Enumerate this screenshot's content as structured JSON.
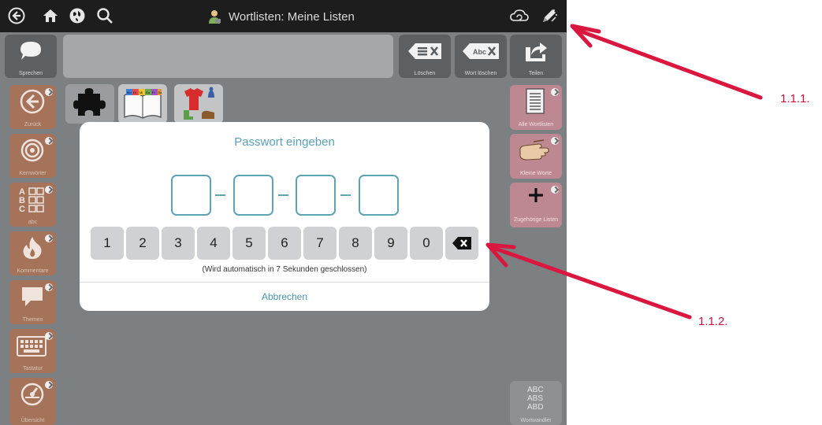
{
  "topbar": {
    "title": "Wortlisten: Meine Listen",
    "icons": [
      "back-icon",
      "home-icon",
      "globe-icon",
      "search-icon",
      "user-icon",
      "cloud-sync-icon",
      "edit-icon"
    ]
  },
  "toolbar": {
    "speak_label": "Sprechen",
    "delete_label": "Löschen",
    "delete_word_label": "Wort löschen",
    "delete_word_icon_text": "Abc",
    "share_label": "Teilen"
  },
  "left_column": {
    "items": [
      {
        "label": "Zurück",
        "icon": "back-arrow-icon"
      },
      {
        "label": "Kernwörter",
        "icon": "target-icon"
      },
      {
        "label": "abc",
        "icon": "alphabet-grid-icon",
        "glyph_letters": "A B C"
      },
      {
        "label": "Kommentare",
        "icon": "fire-icon"
      },
      {
        "label": "Themen",
        "icon": "speech-bubble-icon"
      },
      {
        "label": "Tastatur",
        "icon": "keyboard-icon"
      },
      {
        "label": "Übersicht",
        "icon": "dashboard-icon"
      }
    ]
  },
  "right_column": {
    "items": [
      {
        "label": "Alle Wortlisten",
        "icon": "document-list-icon"
      },
      {
        "label": "Kleine Worte",
        "icon": "hand-icon"
      },
      {
        "label": "Zugehörige Listen",
        "icon": "plus-icon"
      }
    ],
    "wortwandler_label": "Wortwandler",
    "wortwandler_glyph": [
      "ABC",
      "ABS",
      "ABD"
    ]
  },
  "cards": [
    {
      "icon": "puzzle-icon"
    },
    {
      "icon": "weekday-book-icon",
      "days": [
        "Mo",
        "Di",
        "Mi",
        "Do",
        "Fr",
        "Sa"
      ]
    },
    {
      "icon": "clothes-icon"
    }
  ],
  "modal": {
    "title": "Passwort eingeben",
    "keys": [
      "1",
      "2",
      "3",
      "4",
      "5",
      "6",
      "7",
      "8",
      "9",
      "0"
    ],
    "backspace_icon": "backspace-icon",
    "auto_close_text": "(Wird automatisch in 7 Sekunden geschlossen)",
    "cancel_label": "Abbrechen"
  },
  "annotations": {
    "label_1": "1.1.1.",
    "label_2": "1.1.2.",
    "arrow_color": "#d9173f"
  },
  "colors": {
    "accent": "#61a3b4",
    "left_button": "#a5735a",
    "right_button": "#bd8892",
    "background": "#7d8083"
  }
}
